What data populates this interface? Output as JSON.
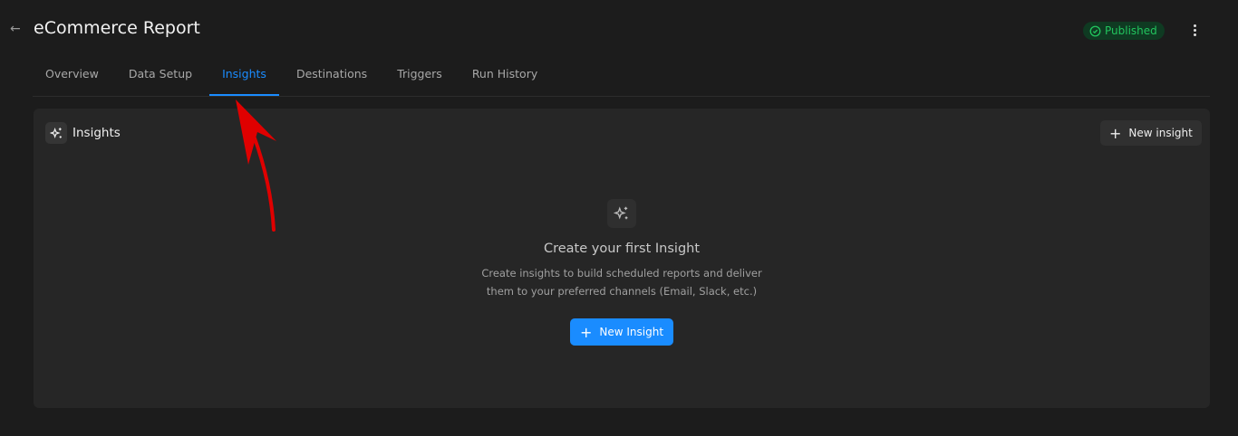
{
  "header": {
    "title": "eCommerce Report",
    "status": "Published",
    "back_icon": "arrow-left-icon",
    "more_icon": "kebab-icon"
  },
  "tabs": [
    {
      "label": "Overview"
    },
    {
      "label": "Data Setup"
    },
    {
      "label": "Insights",
      "active": true
    },
    {
      "label": "Destinations"
    },
    {
      "label": "Triggers"
    },
    {
      "label": "Run History"
    }
  ],
  "panel": {
    "title": "Insights",
    "new_button": "New insight"
  },
  "empty_state": {
    "title": "Create your first Insight",
    "description": "Create insights to build scheduled reports and deliver them to your preferred channels (Email, Slack, etc.)",
    "button": "New Insight"
  },
  "colors": {
    "accent": "#1a8cff",
    "success": "#22c55e",
    "annotation": "#e00000"
  }
}
